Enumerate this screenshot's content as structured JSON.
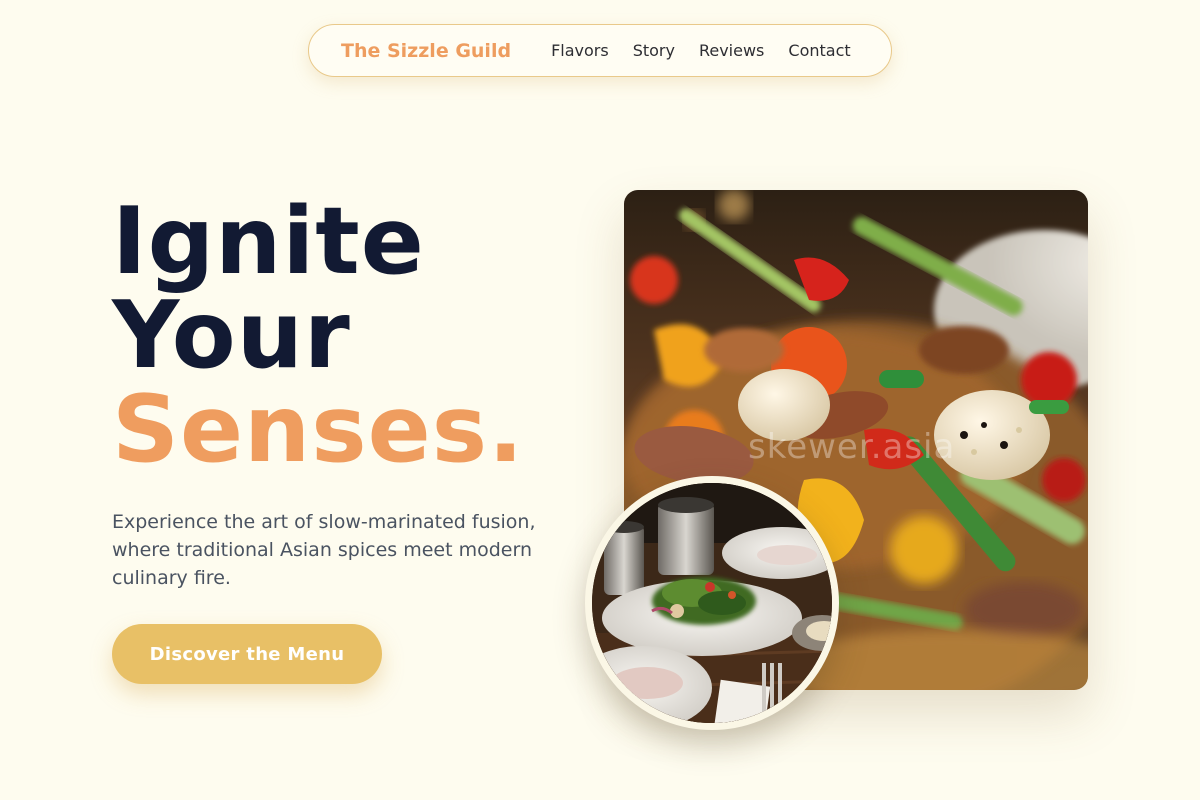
{
  "nav": {
    "brand": "The Sizzle Guild",
    "links": [
      "Flavors",
      "Story",
      "Reviews",
      "Contact"
    ]
  },
  "hero": {
    "headline_line1": "Ignite",
    "headline_line2": "Your",
    "headline_accent": "Senses.",
    "subtext": "Experience the art of slow-marinated fusion, where traditional Asian spices meet modern culinary fire.",
    "cta_label": "Discover the Menu"
  },
  "images": {
    "main_alt": "stir-fried skewer dish with peppers, eggs and greens",
    "main_watermark": "skewer.asia",
    "secondary_alt": "plated salad with cups and cutlery on a wooden table"
  },
  "colors": {
    "background": "#fefcef",
    "brand_orange": "#ee9d5f",
    "headline_navy": "#121a33",
    "cta_gold": "#e8c066",
    "body_text": "#4a5361"
  }
}
